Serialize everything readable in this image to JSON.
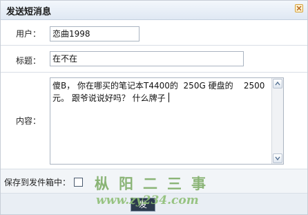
{
  "dialog": {
    "title": "发送短消息"
  },
  "form": {
    "user_label": "用户：",
    "user_value": "恋曲1998",
    "subject_label": "标题：",
    "subject_value": "在不在",
    "content_label": "内容：",
    "content_value": "傻B， 你在哪买的笔记本T4400的  250G 硬盘的    2500 元。 跟爷说说好吗？ 什么牌子",
    "save_label": "保存到发件箱中："
  },
  "footer": {
    "send_label": "发"
  },
  "watermark": {
    "chinese": "枞阳二三事",
    "url": "www.zy234.com"
  },
  "colors": {
    "titlebar": "#dfe8f3",
    "watermark": "#7fae69",
    "border": "#c7cdd6"
  }
}
